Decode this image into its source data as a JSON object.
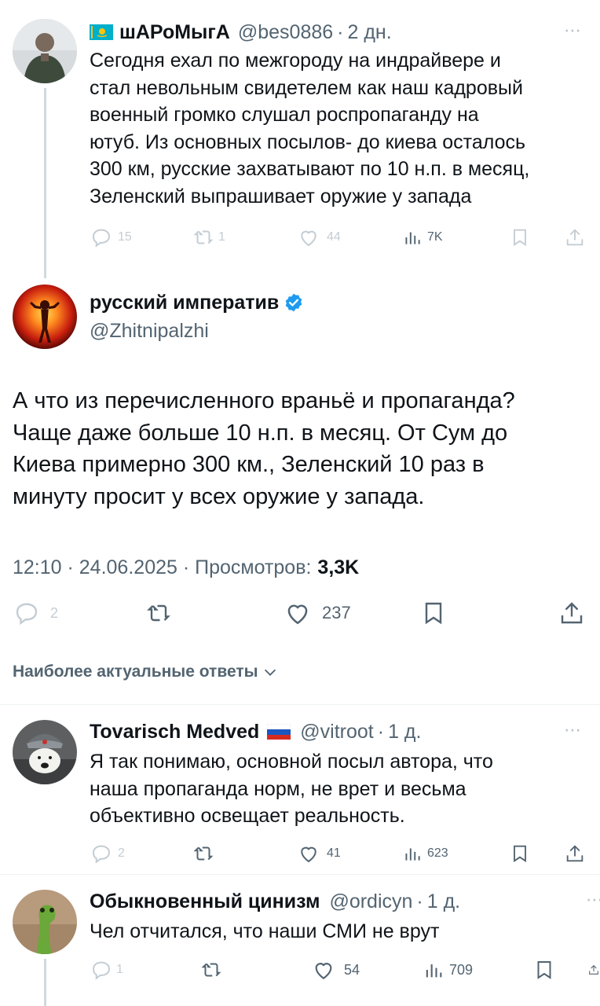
{
  "tweets": [
    {
      "display_name": "шАРоМыгА",
      "handle": "@bes0886",
      "time": "2 дн.",
      "lines": [
        "Сегодня ехал по межгороду на индрайвере и",
        "стал невольным свидетелем как наш кадровый",
        "военный громко слушал роспропаганду на",
        "ютуб. Из основных посылов- до киева осталось",
        "300 км, русские захватывают по 10 н.п. в месяц,",
        "Зеленский выпрашивает оружие у запада"
      ],
      "replies": "15",
      "reposts": "1",
      "likes": "44",
      "views": "7K"
    },
    {
      "display_name": "Tovarisch Medved",
      "handle": "@vitroot",
      "time": "1 д.",
      "lines": [
        "Я так понимаю, основной посыл автора, что",
        "наша пропаганда норм, не врет и весьма",
        "объективно освещает реальность."
      ],
      "replies": "2",
      "likes": "41",
      "views": "623"
    },
    {
      "display_name": "Обыкновенный цинизм",
      "handle": "@ordicyn",
      "time": "1 д.",
      "lines": [
        "Чел отчитался, что наши СМИ не врут"
      ],
      "replies": "1",
      "likes": "54",
      "views": "709"
    }
  ],
  "main": {
    "display_name": "русский императив",
    "handle": "@Zhitnipalzhi",
    "lines": [
      "А что из перечисленного враньё и пропаганда?",
      "Чаще даже больше 10 н.п. в месяц. От Сум до",
      "Киева примерно 300 км., Зеленский 10 раз в",
      "минуту просит у всех оружие у запада."
    ],
    "timestamp": "12:10 · 24.06.2025 · Просмотров:",
    "views": "3,3K",
    "replies": "2",
    "likes": "237"
  },
  "sort_label": "Наиболее актуальные ответы",
  "separator": "·",
  "more_icon": "⋯",
  "colors": {
    "verified": "#1d9bf0",
    "muted": "#536471",
    "thread_line": "#cfd9de"
  }
}
